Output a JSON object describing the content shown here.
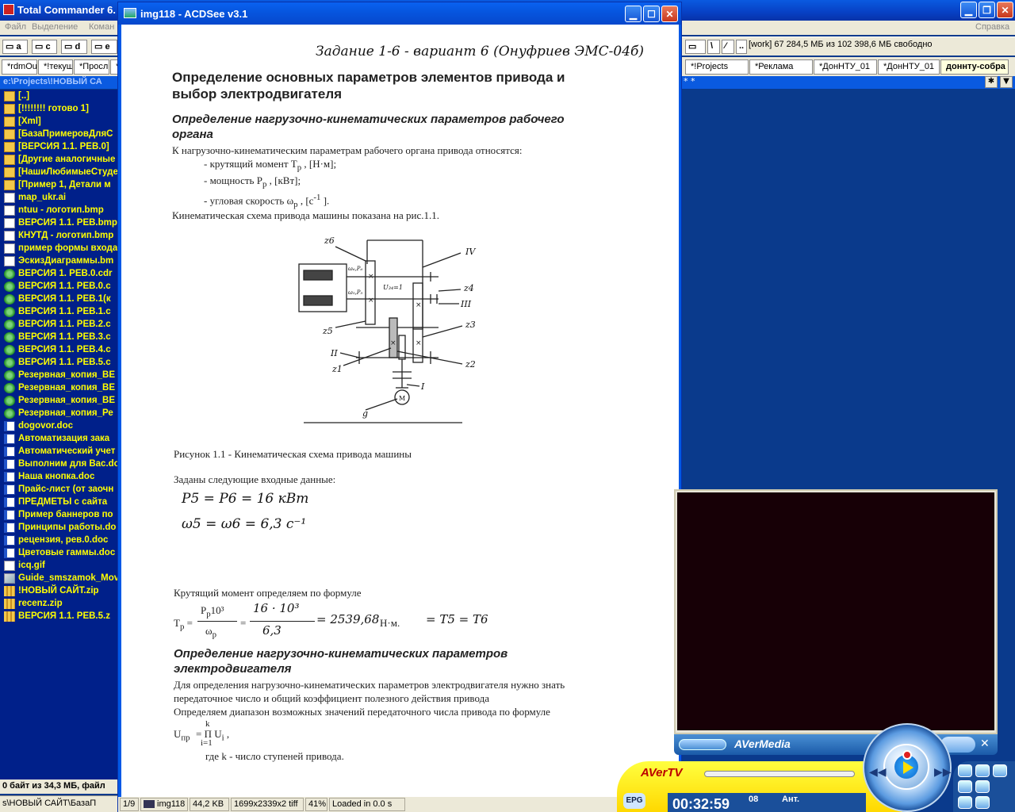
{
  "total_commander": {
    "title": "Total Commander 6.",
    "menu": [
      "Файл",
      "Выделение",
      "Коман",
      "Справка"
    ],
    "drives": [
      "a",
      "c",
      "d",
      "e"
    ],
    "drives_right": [
      "\\",
      ".."
    ],
    "free_space": "[work]  67 284,5 МБ из 102 398,6 МБ свободно",
    "tabs_left": [
      "*rdmOu",
      "*!текущ",
      "*Просл",
      "*"
    ],
    "tabs_right": [
      "*!Projects",
      "*Реклама",
      "*ДонНТУ_01",
      "*ДонНТУ_01",
      "доннту-собра"
    ],
    "path_left": "e:\\Projects\\!НОВЫЙ СА",
    "path_right": "* *",
    "files": [
      {
        "name": "[..]",
        "type": "folder"
      },
      {
        "name": "[!!!!!!!! готово 1]",
        "type": "folder"
      },
      {
        "name": "[Xml]",
        "type": "folder"
      },
      {
        "name": "[БазаПримеровДляС",
        "type": "folder"
      },
      {
        "name": "[ВЕРСИЯ 1.1. РЕВ.0]",
        "type": "folder"
      },
      {
        "name": "[Другие аналогичные",
        "type": "folder"
      },
      {
        "name": "[НашиЛюбимыеСтуде",
        "type": "folder"
      },
      {
        "name": "[Пример 1, Детали м",
        "type": "folder"
      },
      {
        "name": "map_ukr.ai",
        "type": "file"
      },
      {
        "name": "ntuu - логотип.bmp",
        "type": "file"
      },
      {
        "name": "ВЕРСИЯ 1.1. РЕВ.bmp",
        "type": "file"
      },
      {
        "name": "КНУТД - логотип.bmp",
        "type": "file"
      },
      {
        "name": "пример формы входа",
        "type": "file"
      },
      {
        "name": "ЭскизДиаграммы.bm",
        "type": "file"
      },
      {
        "name": "ВЕРСИЯ 1. РЕВ.0.cdr",
        "type": "cdr"
      },
      {
        "name": "ВЕРСИЯ 1.1. РЕВ.0.c",
        "type": "cdr"
      },
      {
        "name": "ВЕРСИЯ 1.1. РЕВ.1(к",
        "type": "cdr"
      },
      {
        "name": "ВЕРСИЯ 1.1. РЕВ.1.c",
        "type": "cdr"
      },
      {
        "name": "ВЕРСИЯ 1.1. РЕВ.2.c",
        "type": "cdr"
      },
      {
        "name": "ВЕРСИЯ 1.1. РЕВ.3.c",
        "type": "cdr"
      },
      {
        "name": "ВЕРСИЯ 1.1. РЕВ.4.c",
        "type": "cdr"
      },
      {
        "name": "ВЕРСИЯ 1.1. РЕВ.5.c",
        "type": "cdr"
      },
      {
        "name": "Резервная_копия_ВЕ",
        "type": "cdr"
      },
      {
        "name": "Резервная_копия_ВЕ",
        "type": "cdr"
      },
      {
        "name": "Резервная_копия_ВЕ",
        "type": "cdr"
      },
      {
        "name": "Резервная_копия_Ре",
        "type": "cdr"
      },
      {
        "name": "dogovor.doc",
        "type": "doc"
      },
      {
        "name": "Автоматизация зака",
        "type": "doc"
      },
      {
        "name": "Автоматический учет",
        "type": "doc"
      },
      {
        "name": "Выполним для Вас.do",
        "type": "doc"
      },
      {
        "name": "Наша кнопка.doc",
        "type": "doc"
      },
      {
        "name": "Прайс-лист (от заочн",
        "type": "doc"
      },
      {
        "name": "ПРЕДМЕТЫ с сайта",
        "type": "doc"
      },
      {
        "name": "Пример баннеров по",
        "type": "doc"
      },
      {
        "name": "Принципы работы.do",
        "type": "doc"
      },
      {
        "name": "рецензия, рев.0.doc",
        "type": "doc"
      },
      {
        "name": "Цветовые гаммы.doc",
        "type": "doc"
      },
      {
        "name": "icq.gif",
        "type": "file"
      },
      {
        "name": "Guide_smszamok_Mov",
        "type": "gif"
      },
      {
        "name": "!НОВЫЙ САЙТ.zip",
        "type": "zip"
      },
      {
        "name": "recenz.zip",
        "type": "zip"
      },
      {
        "name": "ВЕРСИЯ 1.1. РЕВ.5.z",
        "type": "zip"
      }
    ],
    "status_left": "0 байт из 34,3 МБ, файл",
    "cmdline": "s\\НОВЫЙ САЙТ\\БазаП"
  },
  "acdsee": {
    "title": "img118 - ACDSee v3.1",
    "status": [
      "1/9",
      "img118",
      "44,2 KB",
      "1699x2339x2 tiff",
      "41%",
      "Loaded in 0.0 s"
    ],
    "page": {
      "handwritten_header": "Задание 1-6 - вариант 6 (Онуфриев ЭМС-04б)",
      "h1_line1": "Определение основных параметров элементов привода и",
      "h1_line2": "выбор электродвигателя",
      "h2a_line1": "Определение нагрузочно-кинематических параметров рабочего",
      "h2a_line2": "органа",
      "p1": "К нагрузочно-кинематическим параметрам рабочего органа привода относятся:",
      "li1": "- крутящий момент T",
      "li1_sub": "p",
      "li1_tail": " , [Н·м];",
      "li2": "- мощность P",
      "li2_sub": "p",
      "li2_tail": " , [кВт];",
      "li3": "- угловая скорость ω",
      "li3_sub": "p",
      "li3_tail": " , [с",
      "li3_sup": "-1",
      "li3_end": " ].",
      "p2": "Кинематическая схема привода машины показана на рис.1.1.",
      "fig_labels": {
        "z6": "z6",
        "z5": "z5",
        "z4": "z4",
        "z3": "z3",
        "z2": "z2",
        "z1": "z1",
        "IV": "IV",
        "III": "III",
        "II": "II",
        "I": "I",
        "g": "g",
        "M": "M",
        "u": "U₃₄=1",
        "w6": "ω₆,P₆",
        "w5": "ω₅,P₅"
      },
      "caption": "Рисунок 1.1 - Кинематическая схема привода машины",
      "given": "Заданы следующие входные данные:",
      "hw1": "P5 = P6 = 16 кВт",
      "hw2": "ω5 = ω6 = 6,3 с⁻¹",
      "torque_intro": "Крутящий момент определяем по формуле",
      "formula_lhs": "T",
      "formula_lhs_sub": "p",
      "formula_num": "P",
      "formula_num_sub": "p",
      "formula_num_sup": "10³",
      "formula_den": "ω",
      "formula_den_sub": "p",
      "hw_num": "16 · 10³",
      "hw_den": "6,3",
      "hw_result": "= 2539,68",
      "unit": "Н·м.",
      "hw_tail": "= T5 = T6",
      "h2b_line1": "Определение нагрузочно-кинематических параметров",
      "h2b_line2": "электродвигателя",
      "p3_1": "Для определения нагрузочно-кинематических параметров электродвигателя нужно знать",
      "p3_2": "передаточное число и общий коэффициент полезного действия привода",
      "p3_3": "Определяем диапазон возможных значений передаточного числа привода по формуле",
      "u_formula": "U",
      "u_sub": "пр",
      "u_rhs": "= Π U",
      "u_rhs_sub": "i",
      "u_k": "k",
      "u_i1": "i=1",
      "where": "где      k - число ступеней привода."
    }
  },
  "avertv": {
    "brand_bar": "AVerMedia",
    "brand": "AVerTV",
    "time": "00:32:59",
    "channel": "08",
    "input": "Ант.",
    "epg": "EPG"
  }
}
